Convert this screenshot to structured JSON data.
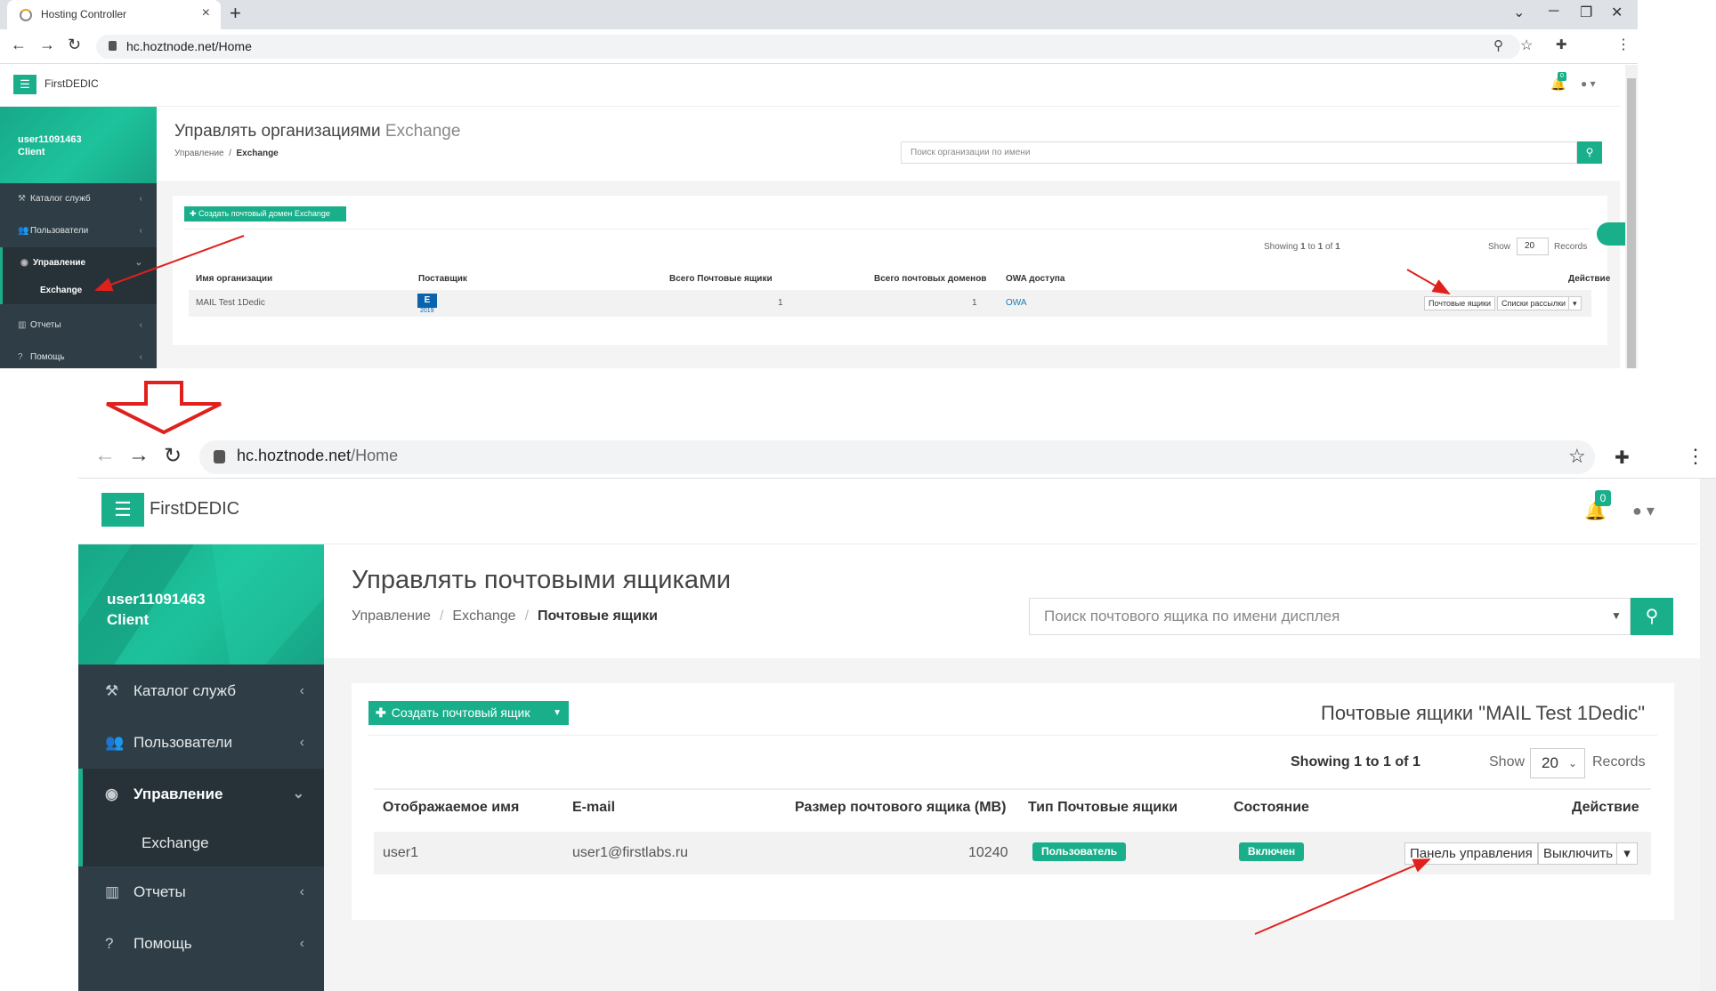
{
  "shot1": {
    "tab_title": "Hosting Controller",
    "new_tab": "+",
    "url": "hc.hoztnode.net/Home",
    "brand": "FirstDEDIC",
    "notif_count": "0",
    "user": {
      "name": "user11091463",
      "role": "Client"
    },
    "nav": [
      {
        "label": "Каталог служб"
      },
      {
        "label": "Пользователи"
      },
      {
        "label": "Управление"
      },
      {
        "label": "Отчеты"
      },
      {
        "label": "Помощь"
      }
    ],
    "nav_sub": "Exchange",
    "page_title": "Управлять организациями",
    "page_title_muted": "Exchange",
    "breadcrumb": [
      "Управление",
      "Exchange"
    ],
    "search_placeholder": "Поиск организации по имени",
    "create_button": "Создать почтовый домен Exchange",
    "showing": {
      "prefix": "Showing",
      "from": "1",
      "to_word": "to",
      "to": "1",
      "of_word": "of",
      "total": "1"
    },
    "show_label": "Show",
    "page_size": "20",
    "records_label": "Records",
    "columns": [
      "Имя организации",
      "Поставщик",
      "Всего Почтовые ящики",
      "Всего почтовых доменов",
      "OWA доступа",
      "Действие"
    ],
    "row": {
      "org": "MAIL Test 1Dedic",
      "provider_logo": "E",
      "provider_year": "2019",
      "mailboxes": "1",
      "domains": "1",
      "owa": "OWA"
    },
    "actions": [
      "Почтовые ящики",
      "Списки рассылки"
    ]
  },
  "shot2": {
    "url_host": "hc.hoztnode.net",
    "url_path": "/Home",
    "brand": "FirstDEDIC",
    "notif_count": "0",
    "user": {
      "name": "user11091463",
      "role": "Client"
    },
    "nav": [
      {
        "label": "Каталог служб"
      },
      {
        "label": "Пользователи"
      },
      {
        "label": "Управление"
      },
      {
        "label": "Отчеты"
      },
      {
        "label": "Помощь"
      }
    ],
    "nav_sub": "Exchange",
    "page_title": "Управлять почтовыми ящиками",
    "breadcrumb": [
      "Управление",
      "Exchange",
      "Почтовые ящики"
    ],
    "search_placeholder": "Поиск почтового ящика по имени дисплея",
    "create_button": "Создать почтовый ящик",
    "panel_title": "Почтовые ящики \"MAIL Test 1Dedic\"",
    "showing": {
      "prefix": "Showing",
      "from": "1",
      "to_word": "to",
      "to": "1",
      "of_word": "of",
      "total": "1"
    },
    "show_label": "Show",
    "page_size": "20",
    "records_label": "Records",
    "columns": [
      "Отображаемое имя",
      "E-mail",
      "Размер почтового ящика (MB)",
      "Тип Почтовые ящики",
      "Состояние",
      "Действие"
    ],
    "row": {
      "name": "user1",
      "email": "user1@firstlabs.ru",
      "size": "10240",
      "type": "Пользователь",
      "status": "Включен"
    },
    "actions": [
      "Панель управления",
      "Выключить"
    ]
  },
  "colors": {
    "accent": "#1aaf8b",
    "sidebar": "#2f3e46",
    "annotation": "#e0201c"
  },
  "icons": [
    "back-icon",
    "forward-icon",
    "reload-icon",
    "lock-icon",
    "zoom-icon",
    "star-icon",
    "extensions-icon",
    "menu-dots-icon",
    "hamburger-icon",
    "bell-icon",
    "user-icon",
    "gavel-icon",
    "users-icon",
    "globe-icon",
    "chart-icon",
    "question-icon",
    "search-icon",
    "chevron-icon",
    "caret-down-icon"
  ]
}
